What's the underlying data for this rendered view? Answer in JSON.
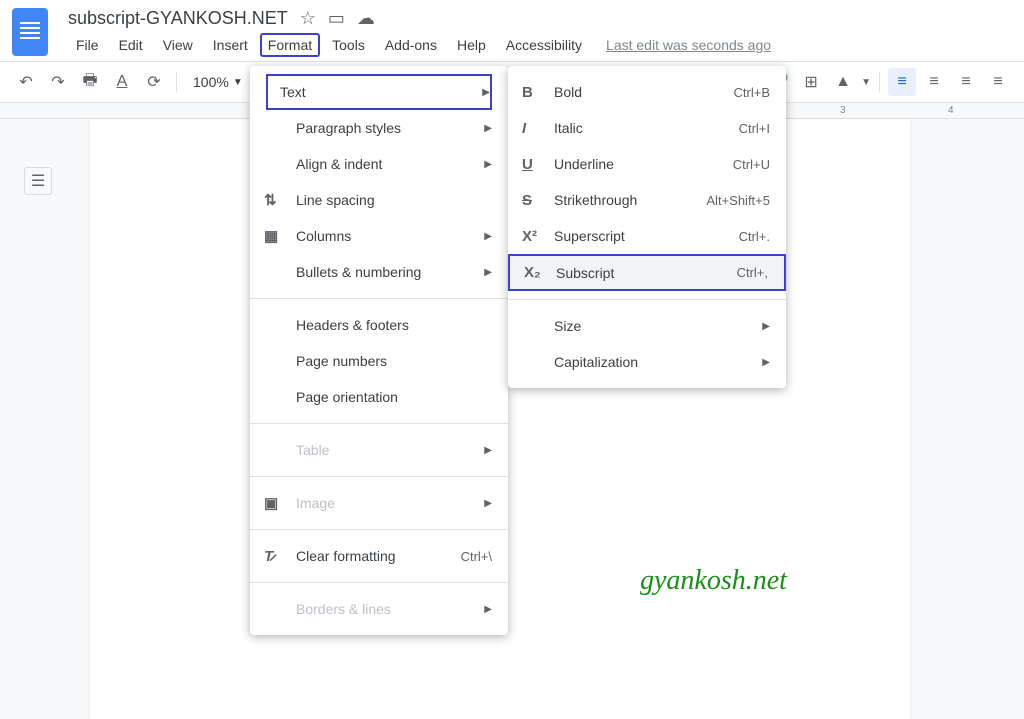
{
  "document": {
    "title": "subscript-GYANKOSH.NET"
  },
  "menubar": {
    "file": "File",
    "edit": "Edit",
    "view": "View",
    "insert": "Insert",
    "format": "Format",
    "tools": "Tools",
    "addons": "Add-ons",
    "help": "Help",
    "accessibility": "Accessibility",
    "lastEdit": "Last edit was seconds ago"
  },
  "toolbar": {
    "zoom": "100%"
  },
  "ruler": {
    "mark3": "3",
    "mark4": "4"
  },
  "formatMenu": {
    "text": "Text",
    "paragraph": "Paragraph styles",
    "align": "Align & indent",
    "lineSpacing": "Line spacing",
    "columns": "Columns",
    "bullets": "Bullets & numbering",
    "headers": "Headers & footers",
    "pageNumbers": "Page numbers",
    "pageOrientation": "Page orientation",
    "table": "Table",
    "image": "Image",
    "clearFormatting": "Clear formatting",
    "clearFormattingShortcut": "Ctrl+\\",
    "borders": "Borders & lines"
  },
  "textSubmenu": {
    "bold": "Bold",
    "boldShortcut": "Ctrl+B",
    "italic": "Italic",
    "italicShortcut": "Ctrl+I",
    "underline": "Underline",
    "underlineShortcut": "Ctrl+U",
    "strikethrough": "Strikethrough",
    "strikethroughShortcut": "Alt+Shift+5",
    "superscript": "Superscript",
    "superscriptShortcut": "Ctrl+.",
    "subscript": "Subscript",
    "subscriptShortcut": "Ctrl+,",
    "size": "Size",
    "capitalization": "Capitalization"
  },
  "watermark": "gyankosh.net"
}
